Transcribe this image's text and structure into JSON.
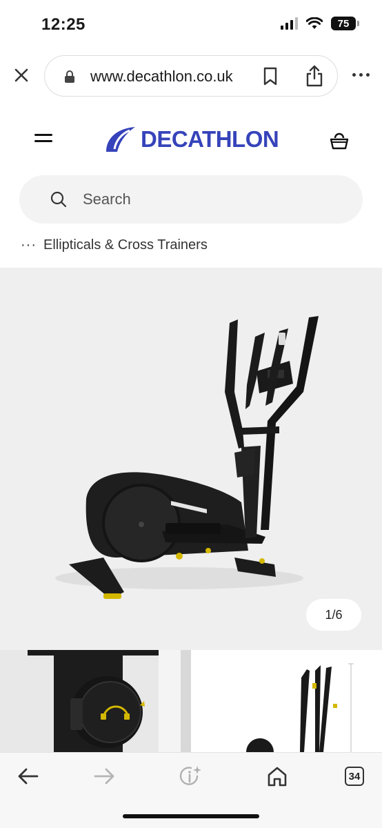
{
  "status_bar": {
    "time": "12:25",
    "battery": "75",
    "icons": [
      "signal-icon",
      "wifi-icon",
      "battery-icon"
    ]
  },
  "browser": {
    "url": "www.decathlon.co.uk",
    "icons": [
      "close-icon",
      "lock-icon",
      "bookmark-icon",
      "share-icon",
      "more-icon"
    ]
  },
  "site": {
    "brand": "DECATHLON",
    "brand_color": "#3643ba",
    "search_placeholder": "Search",
    "breadcrumb_dots": "···",
    "breadcrumb_label": "Ellipticals & Cross Trainers"
  },
  "gallery": {
    "pager": "1/6",
    "current_index": 1,
    "total_images": 6
  },
  "toolbar": {
    "tabs_count": "34",
    "icons": [
      "back-arrow-icon",
      "forward-arrow-icon",
      "info-sparkle-icon",
      "home-icon",
      "tabs-icon"
    ]
  }
}
